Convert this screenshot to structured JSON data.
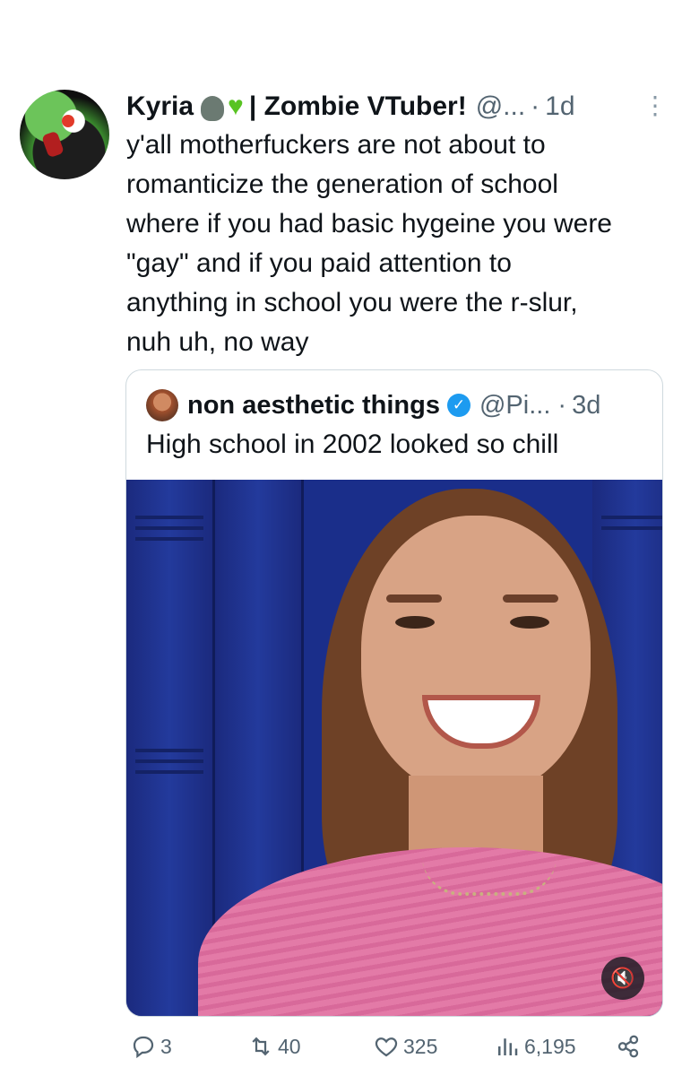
{
  "tweet": {
    "author_name": "Kyria",
    "author_suffix": "| Zombie VTuber!",
    "handle": "@...",
    "dot": "·",
    "time": "1d",
    "more_icon": "ellipsis-vertical",
    "text": "y'all motherfuckers are not about to\nromanticize the generation of school\nwhere if you had basic hygeine you were\n\"gay\" and if you paid attention to\nanything in school you were the r-slur,\nnuh uh, no way"
  },
  "quote": {
    "author_name": "non aesthetic things",
    "verified_icon": "verified-badge",
    "handle": "@Pi...",
    "dot": "·",
    "time": "3d",
    "text": "High school in 2002 looked so chill",
    "mute_icon": "volume-mute"
  },
  "actions": {
    "replies": "3",
    "reposts": "40",
    "likes": "325",
    "views": "6,195"
  },
  "colors": {
    "text": "#0f1419",
    "muted": "#536471",
    "border": "#cfd9de",
    "verified": "#1d9bf0",
    "heart_emoji": "#58c322"
  }
}
